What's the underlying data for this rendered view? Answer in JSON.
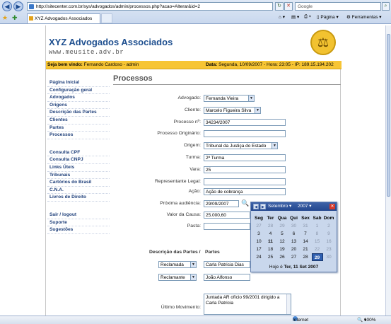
{
  "browser": {
    "address": "http://sitecenter.com.br/sys/advogados/admin/processos.php?acao=Alterar&id=2",
    "search_placeholder": "Google",
    "tab_title": "XYZ Advogados Associados",
    "page_menu": "Página",
    "tools_menu": "Ferramentas"
  },
  "header": {
    "brand": "XYZ Advogados Associados",
    "site": "www.meusite.adv.br",
    "logo_icon": "scales-of-justice-icon"
  },
  "welcome": {
    "prefix": "Seja bem vindo:",
    "user": "Fernando Cardoso - admin",
    "date_label": "Data:",
    "date": "Segunda, 10/09/2007 - Hora: 23:05 - IP: 189.15.194.202"
  },
  "sidebar": {
    "group1": [
      "Página Inicial",
      "Configuração geral",
      "Advogados",
      "Origens",
      "Descrição das Partes",
      "Clientes",
      "Partes",
      "Processos"
    ],
    "group2": [
      "Consulta CPF",
      "Consulta CNPJ",
      "Links Úteis",
      "Tribunais",
      "Cartórios do Brasil",
      "C.N.A.",
      "Livros de Direito"
    ],
    "group3": [
      "Sair / logout",
      "Suporte",
      "Sugestões"
    ]
  },
  "main": {
    "title": "Processos",
    "fields": {
      "advogado_label": "Advogado:",
      "advogado_value": "Fernanda Vieira",
      "cliente_label": "Cliente:",
      "cliente_value": "Marcelo Figueira Silva",
      "processo_label": "Processo nº:",
      "processo_value": "34234/2007",
      "proc_orig_label": "Processo Originário:",
      "proc_orig_value": "",
      "origem_label": "Origem:",
      "origem_value": "Tribunal da Justiça do Estado",
      "turma_label": "Turma:",
      "turma_value": "2ª Turma",
      "vara_label": "Vara:",
      "vara_value": "25",
      "rep_label": "Representante Legal:",
      "rep_value": "",
      "acao_label": "Ação:",
      "acao_value": "Ação de cobrança",
      "prox_label": "Próxima audiência:",
      "prox_value": "29/09/2007",
      "valor_label": "Valor da Causa:",
      "valor_value": "25.000,60",
      "pasta_label": "Pasta:",
      "pasta_value": ""
    },
    "partes_header_left": "Descrição das Partes /",
    "partes_header_right": "Partes",
    "partes": [
      {
        "tipo": "Reclamada",
        "nome": "Carla Patricia Dias"
      },
      {
        "tipo": "Reclamante",
        "nome": "João Alfonso"
      }
    ],
    "ultimo_label": "Último Movimento:",
    "ultimo_value": "Juntada AR ofício 99/2001 dirigido a Carla Patricia"
  },
  "calendar": {
    "month": "Setembro",
    "year": "2007",
    "dows": [
      "Seg",
      "Ter",
      "Qua",
      "Qui",
      "Sex",
      "Sab",
      "Dom"
    ],
    "weeks": [
      [
        "27",
        "28",
        "29",
        "30",
        "31",
        "1",
        "2"
      ],
      [
        "3",
        "4",
        "5",
        "6",
        "7",
        "8",
        "9"
      ],
      [
        "10",
        "11",
        "12",
        "13",
        "14",
        "15",
        "16"
      ],
      [
        "17",
        "18",
        "19",
        "20",
        "21",
        "22",
        "23"
      ],
      [
        "24",
        "25",
        "26",
        "27",
        "28",
        "29",
        "30"
      ]
    ],
    "footer": "Hoje é",
    "today": "Ter, 11 Set 2007",
    "selected_day": "29"
  },
  "status": {
    "zone": "Internet",
    "zoom": "100%"
  }
}
